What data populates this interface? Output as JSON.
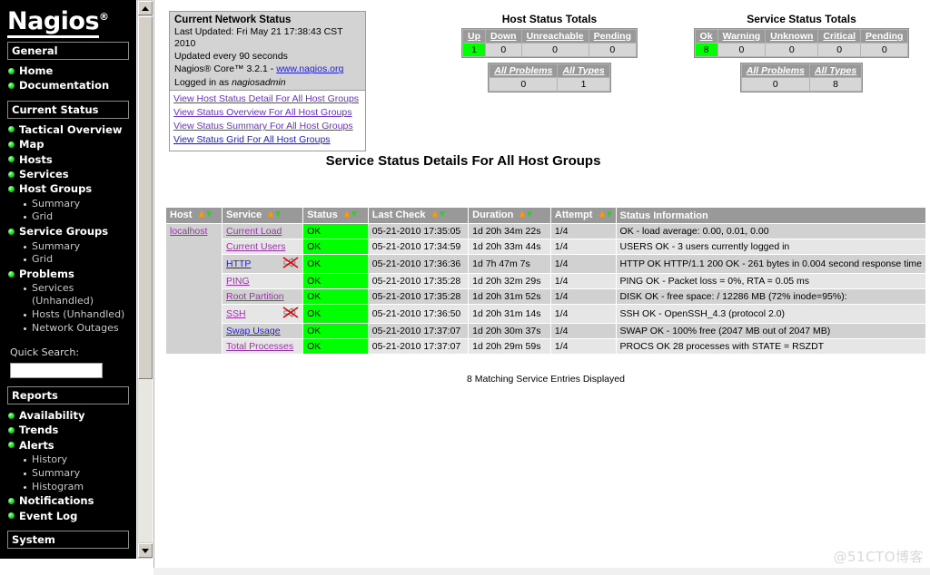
{
  "sidebar": {
    "logo": {
      "text": "Nagios",
      "registered": "®"
    },
    "sections": [
      {
        "header": "General",
        "items": [
          {
            "label": "Home",
            "type": "top"
          },
          {
            "label": "Documentation",
            "type": "top"
          }
        ]
      },
      {
        "header": "Current Status",
        "items": [
          {
            "label": "Tactical Overview",
            "type": "top"
          },
          {
            "label": "Map",
            "type": "top"
          },
          {
            "label": "Hosts",
            "type": "top"
          },
          {
            "label": "Services",
            "type": "top"
          },
          {
            "label": "Host Groups",
            "type": "top"
          },
          {
            "label": "Summary",
            "type": "sub"
          },
          {
            "label": "Grid",
            "type": "sub"
          },
          {
            "label": "Service Groups",
            "type": "top"
          },
          {
            "label": "Summary",
            "type": "sub"
          },
          {
            "label": "Grid",
            "type": "sub"
          },
          {
            "label": "Problems",
            "type": "top"
          },
          {
            "label": "Services (Unhandled)",
            "type": "sub"
          },
          {
            "label": "Hosts (Unhandled)",
            "type": "sub"
          },
          {
            "label": "Network Outages",
            "type": "sub"
          }
        ]
      },
      {
        "header": "Reports",
        "items": [
          {
            "label": "Availability",
            "type": "top"
          },
          {
            "label": "Trends",
            "type": "top"
          },
          {
            "label": "Alerts",
            "type": "top"
          },
          {
            "label": "History",
            "type": "sub"
          },
          {
            "label": "Summary",
            "type": "sub"
          },
          {
            "label": "Histogram",
            "type": "sub"
          },
          {
            "label": "Notifications",
            "type": "top"
          },
          {
            "label": "Event Log",
            "type": "top"
          }
        ]
      },
      {
        "header": "System",
        "items": []
      }
    ],
    "quick_search": {
      "label": "Quick Search:",
      "value": "",
      "placeholder": ""
    }
  },
  "status_box": {
    "title": "Current Network Status",
    "last_updated": "Last Updated: Fri May 21 17:38:43 CST 2010",
    "update_interval": "Updated every 90 seconds",
    "version_prefix": "Nagios® Core™ 3.2.1 - ",
    "version_link": "www.nagios.org",
    "logged_in_prefix": "Logged in as ",
    "logged_in_user": "nagiosadmin",
    "links": [
      "View Host Status Detail For All Host Groups",
      "View Status Overview For All Host Groups",
      "View Status Summary For All Host Groups",
      "View Status Grid For All Host Groups"
    ]
  },
  "host_totals": {
    "title": "Host Status Totals",
    "headers": [
      "Up",
      "Down",
      "Unreachable",
      "Pending"
    ],
    "values": [
      "1",
      "0",
      "0",
      "0"
    ],
    "ok_index": 0,
    "sub_headers": [
      "All Problems",
      "All Types"
    ],
    "sub_values": [
      "0",
      "1"
    ]
  },
  "service_totals": {
    "title": "Service Status Totals",
    "headers": [
      "Ok",
      "Warning",
      "Unknown",
      "Critical",
      "Pending"
    ],
    "values": [
      "8",
      "0",
      "0",
      "0",
      "0"
    ],
    "ok_index": 0,
    "sub_headers": [
      "All Problems",
      "All Types"
    ],
    "sub_values": [
      "0",
      "8"
    ]
  },
  "section_title": "Service Status Details For All Host Groups",
  "service_table": {
    "headers": [
      "Host",
      "Service",
      "Status",
      "Last Check",
      "Duration",
      "Attempt",
      "Status Information"
    ],
    "host_label": "localhost",
    "rows": [
      {
        "service": "Current Load",
        "link_style": "visited",
        "notifications_disabled": false,
        "status": "OK",
        "last_check": "05-21-2010 17:35:05",
        "duration": "1d 20h 34m 22s",
        "attempt": "1/4",
        "info": "OK - load average: 0.00, 0.01, 0.00"
      },
      {
        "service": "Current Users",
        "link_style": "visited",
        "notifications_disabled": false,
        "status": "OK",
        "last_check": "05-21-2010 17:34:59",
        "duration": "1d 20h 33m 44s",
        "attempt": "1/4",
        "info": "USERS OK - 3 users currently logged in"
      },
      {
        "service": "HTTP",
        "link_style": "unvisited",
        "notifications_disabled": true,
        "status": "OK",
        "last_check": "05-21-2010 17:36:36",
        "duration": "1d 7h 47m 7s",
        "attempt": "1/4",
        "info": "HTTP OK HTTP/1.1 200 OK - 261 bytes in 0.004 second response time"
      },
      {
        "service": "PING",
        "link_style": "visited",
        "notifications_disabled": false,
        "status": "OK",
        "last_check": "05-21-2010 17:35:28",
        "duration": "1d 20h 32m 29s",
        "attempt": "1/4",
        "info": "PING OK - Packet loss = 0%, RTA = 0.05 ms"
      },
      {
        "service": "Root Partition",
        "link_style": "visited",
        "notifications_disabled": false,
        "status": "OK",
        "last_check": "05-21-2010 17:35:28",
        "duration": "1d 20h 31m 52s",
        "attempt": "1/4",
        "info": "DISK OK - free space: / 12286 MB (72% inode=95%):"
      },
      {
        "service": "SSH",
        "link_style": "visited",
        "notifications_disabled": true,
        "status": "OK",
        "last_check": "05-21-2010 17:36:50",
        "duration": "1d 20h 31m 14s",
        "attempt": "1/4",
        "info": "SSH OK - OpenSSH_4.3 (protocol 2.0)"
      },
      {
        "service": "Swap Usage",
        "link_style": "unvisited",
        "notifications_disabled": false,
        "status": "OK",
        "last_check": "05-21-2010 17:37:07",
        "duration": "1d 20h 30m 37s",
        "attempt": "1/4",
        "info": "SWAP OK - 100% free (2047 MB out of 2047 MB)"
      },
      {
        "service": "Total Processes",
        "link_style": "visited",
        "notifications_disabled": false,
        "status": "OK",
        "last_check": "05-21-2010 17:37:07",
        "duration": "1d 20h 29m 59s",
        "attempt": "1/4",
        "info": "PROCS OK 28 processes with STATE = RSZDT"
      }
    ],
    "match_note": "8 Matching Service Entries Displayed"
  },
  "watermark": "@51CTO博客",
  "colors": {
    "ok_green": "#00ff00",
    "header_gray": "#999999",
    "sidebar_bg": "#000000",
    "link_visited": "#9933aa",
    "link_unvisited": "#2222cc"
  }
}
